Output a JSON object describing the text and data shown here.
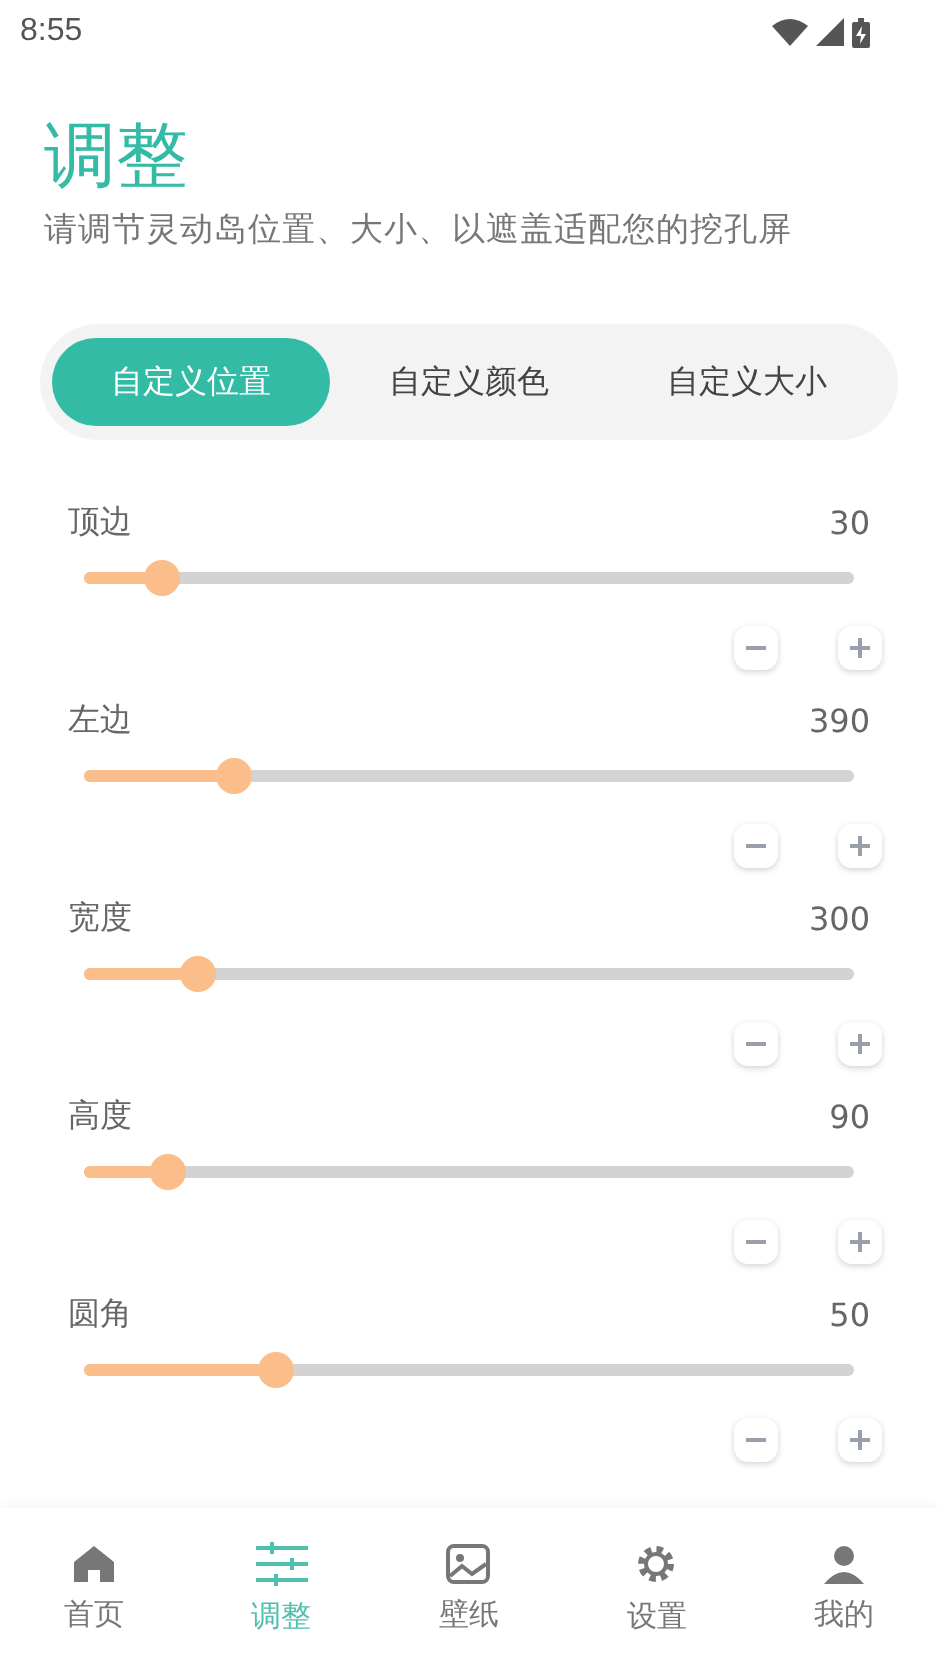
{
  "status_bar": {
    "time": "8:55"
  },
  "header": {
    "title": "调整",
    "subtitle": "请调节灵动岛位置、大小、以遮盖适配您的挖孔屏"
  },
  "tabs": [
    {
      "label": "自定义位置",
      "selected": true
    },
    {
      "label": "自定义颜色",
      "selected": false
    },
    {
      "label": "自定义大小",
      "selected": false
    }
  ],
  "sliders": [
    {
      "label": "顶边",
      "reading": "30",
      "level": 0.1
    },
    {
      "label": "左边",
      "reading": "390",
      "level": 0.195
    },
    {
      "label": "宽度",
      "reading": "300",
      "level": 0.148
    },
    {
      "label": "高度",
      "reading": "90",
      "level": 0.11
    },
    {
      "label": "圆角",
      "reading": "50",
      "level": 0.25
    }
  ],
  "nav": [
    {
      "label": "首页",
      "kind": "home",
      "selected": false
    },
    {
      "label": "调整",
      "kind": "adjust",
      "selected": true
    },
    {
      "label": "壁纸",
      "kind": "wallpaper",
      "selected": false
    },
    {
      "label": "设置",
      "kind": "settings",
      "selected": false
    },
    {
      "label": "我的",
      "kind": "profile",
      "selected": false
    }
  ]
}
